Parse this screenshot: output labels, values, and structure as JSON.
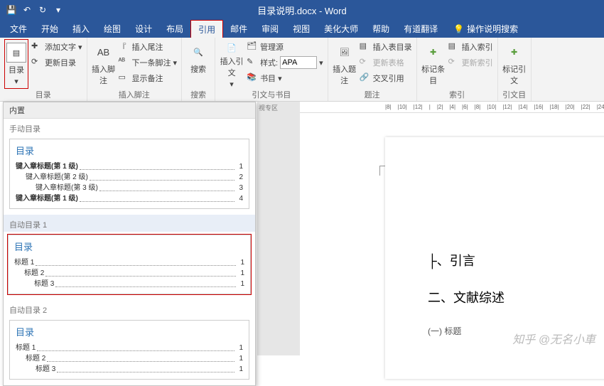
{
  "title": "目录说明.docx - Word",
  "qat": {
    "save": "💾",
    "undo": "↶",
    "redo": "↻"
  },
  "menu": [
    "文件",
    "开始",
    "插入",
    "绘图",
    "设计",
    "布局",
    "引用",
    "邮件",
    "审阅",
    "视图",
    "美化大师",
    "帮助",
    "有道翻译"
  ],
  "active_tab": "引用",
  "tell_me": "操作说明搜索",
  "ribbon": {
    "toc_btn": "目录",
    "add_text": "添加文字",
    "update_toc": "更新目录",
    "insert_footnote": "插入脚注",
    "ab": "AB",
    "insert_endnote": "插入尾注",
    "next_footnote": "下一条脚注",
    "show_notes": "显示备注",
    "search": "搜索",
    "insert_citation": "插入引文",
    "manage_sources": "管理源",
    "style_label": "样式:",
    "style_value": "APA",
    "bibliography": "书目",
    "g_citations": "引文与书目",
    "insert_caption": "插入题注",
    "insert_fig_toc": "插入表目录",
    "update_table": "更新表格",
    "cross_ref": "交叉引用",
    "g_captions": "题注",
    "mark_entry": "标记条目",
    "insert_index": "插入索引",
    "update_index": "更新索引",
    "g_index": "索引",
    "mark_citation": "标记引文",
    "g_toa": "引文目"
  },
  "dd": {
    "builtin": "内置",
    "manual": "手动目录",
    "toc_word": "目录",
    "m1": "键入章标题(第 1 级)",
    "p1": "1",
    "m2": "键入章标题(第 2 级)",
    "p2": "2",
    "m3": "键入章标题(第 3 级)",
    "p3": "3",
    "m4": "键入章标题(第 1 级)",
    "p4": "4",
    "auto1": "自动目录 1",
    "a11": "标题 1",
    "a12": "标题 2",
    "a13": "标题 3",
    "auto2": "自动目录 2"
  },
  "doc": {
    "ruler_hint": "视专区",
    "h1a": "├、引言",
    "h1b": "二、文献综述",
    "h2a": "(一) 标题"
  },
  "watermark": "知乎 @无名小車"
}
